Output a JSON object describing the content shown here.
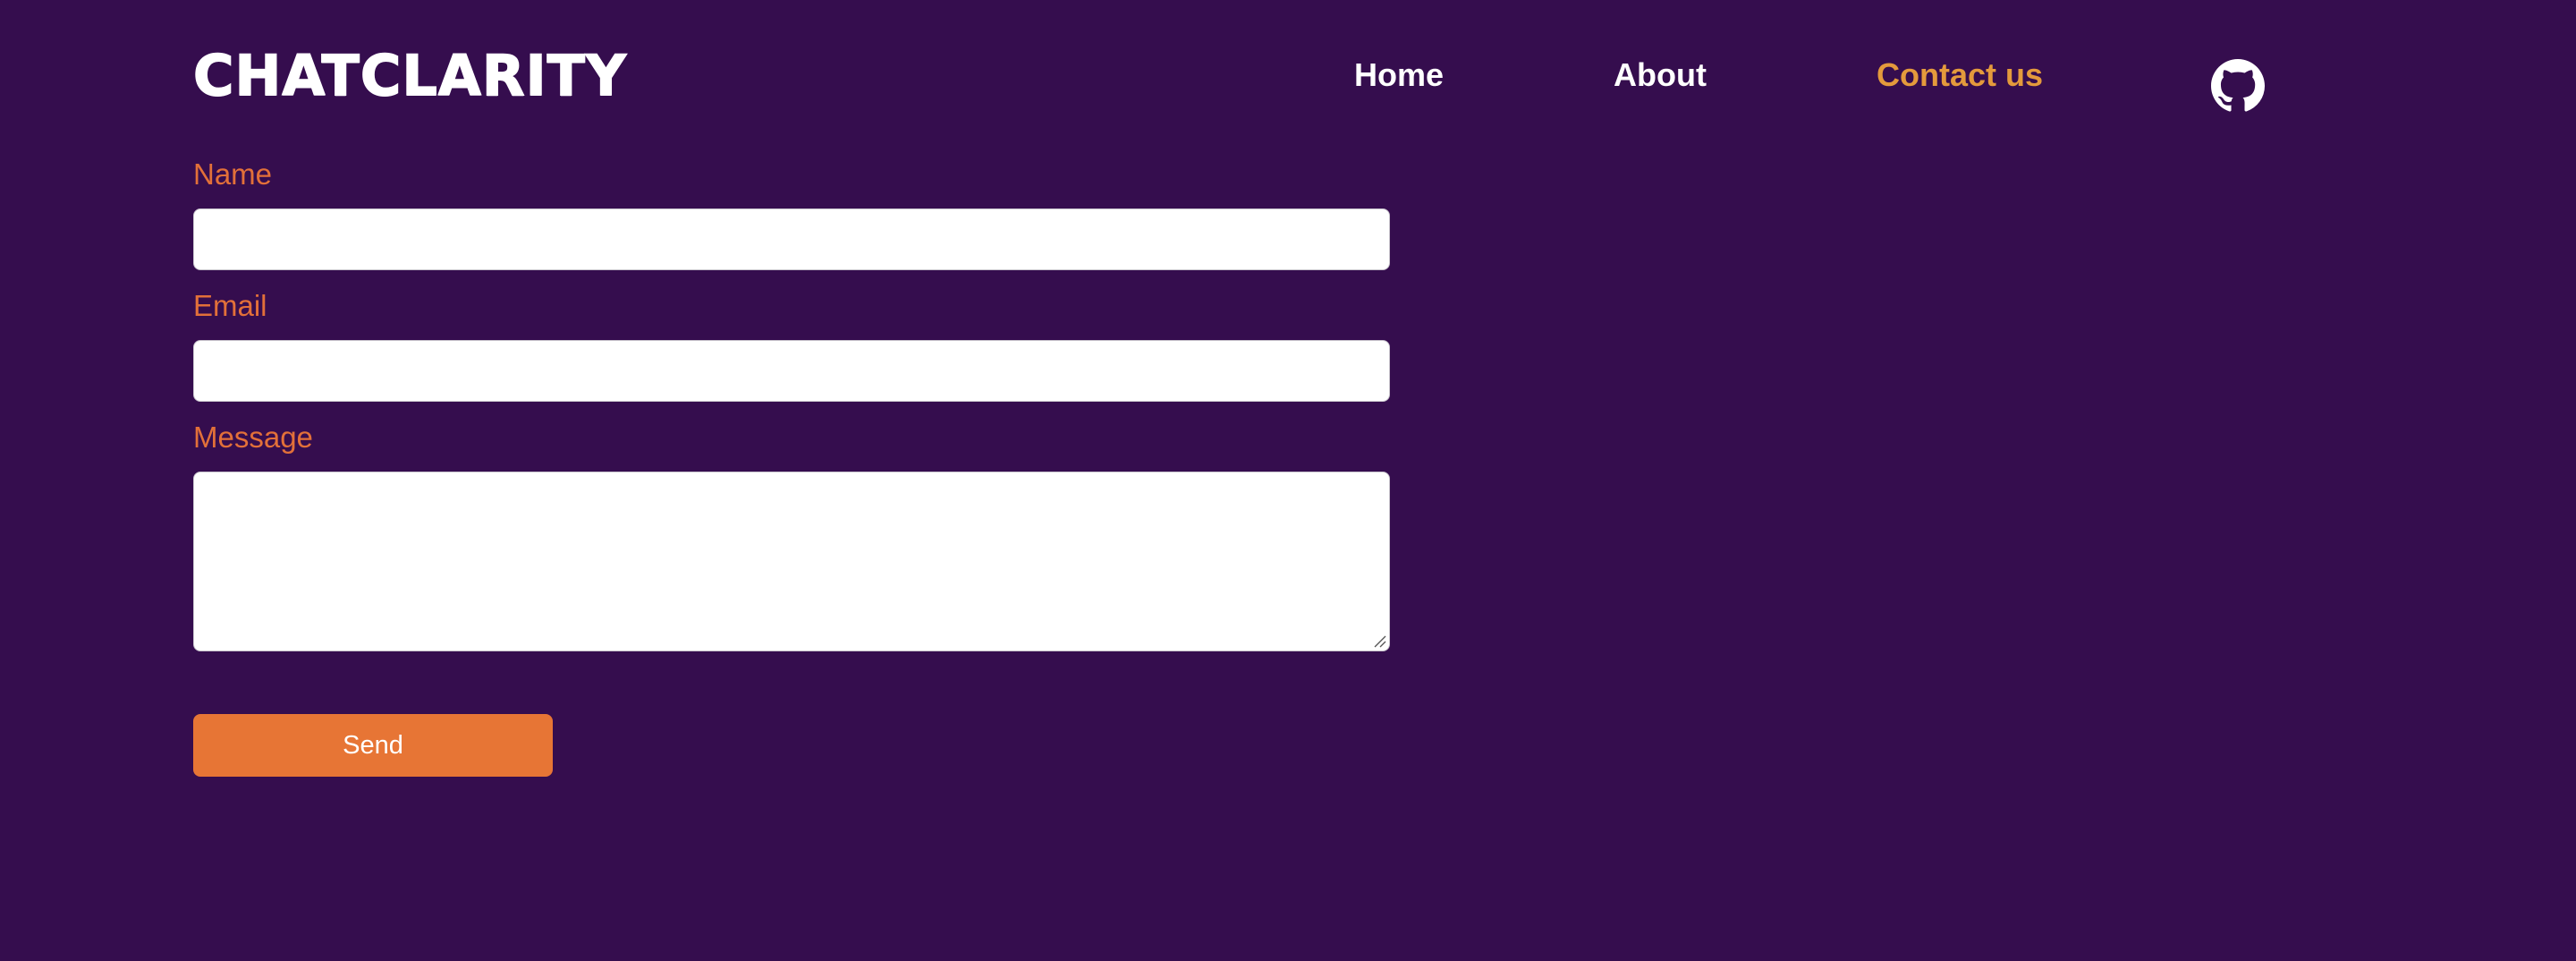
{
  "header": {
    "logo_text": "CHATCLARITY",
    "nav": {
      "home": "Home",
      "about": "About",
      "contact": "Contact us"
    },
    "github_icon": "github-icon"
  },
  "form": {
    "name_label": "Name",
    "name_value": "",
    "email_label": "Email",
    "email_value": "",
    "message_label": "Message",
    "message_value": "",
    "send_label": "Send"
  },
  "colors": {
    "background": "#350d4e",
    "label": "#e27039",
    "active_nav": "#e49a3c",
    "button": "#e77535",
    "text_light": "#ffffff"
  }
}
